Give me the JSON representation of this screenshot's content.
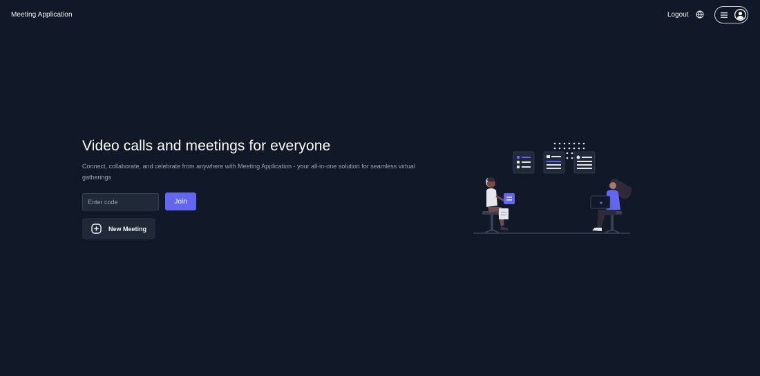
{
  "header": {
    "brand": "Meeting Application",
    "logout_label": "Logout",
    "language_icon": "globe-icon",
    "menu_icon": "hamburger-menu-icon",
    "avatar_icon": "user-avatar-icon"
  },
  "hero": {
    "title": "Video calls and meetings for everyone",
    "subtitle": "Connect, collaborate, and celebrate from anywhere with Meeting Application - your all-in-one solution for seamless virtual gatherings"
  },
  "join": {
    "placeholder": "Enter code",
    "value": "",
    "button_label": "Join"
  },
  "new_meeting": {
    "label": "New Meeting",
    "icon": "plus-square-icon"
  },
  "colors": {
    "background": "#111827",
    "accent": "#6366f1",
    "surface": "#1f2937"
  }
}
